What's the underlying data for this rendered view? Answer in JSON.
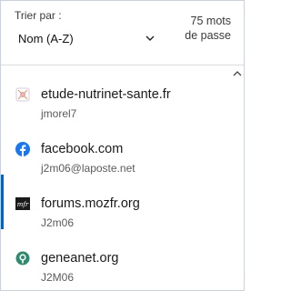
{
  "header": {
    "sort_label": "Trier par :",
    "sort_value": "Nom (A-Z)",
    "count_line1": "75 mots",
    "count_line2": "de passe"
  },
  "items": [
    {
      "site": "etude-nutrinet-sante.fr",
      "user": "jmorel7",
      "icon": "nutrinet-favicon-icon",
      "selected": false
    },
    {
      "site": "facebook.com",
      "user": "j2m06@laposte.net",
      "icon": "facebook-icon",
      "selected": false
    },
    {
      "site": "forums.mozfr.org",
      "user": "J2m06",
      "icon": "mozfr-icon",
      "selected": true
    },
    {
      "site": "geneanet.org",
      "user": "J2M06",
      "icon": "geneanet-icon",
      "selected": false
    }
  ],
  "colors": {
    "accent": "#0067c0",
    "facebook": "#1877f2",
    "geneanet": "#2e8b6e"
  }
}
